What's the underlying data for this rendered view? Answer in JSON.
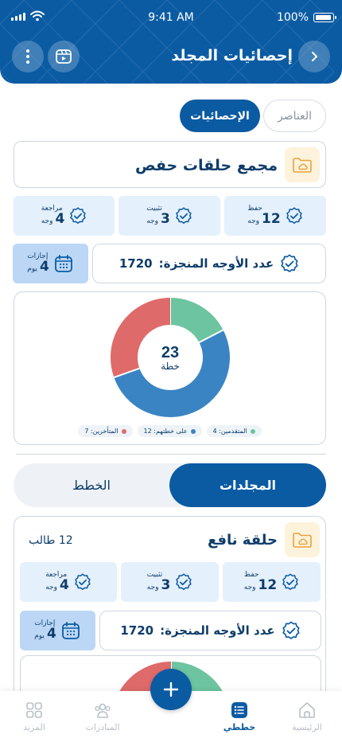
{
  "status_bar": {
    "time": "9:41 AM",
    "battery": "100%"
  },
  "header": {
    "title": "إحصائيات المجلد"
  },
  "top_tabs": {
    "stats": "الإحصائيات",
    "items": "العناصر"
  },
  "folder": {
    "title": "مجمع حلقات حفص",
    "tiles": [
      {
        "label": "حفظ",
        "value": "12",
        "unit": "وجه"
      },
      {
        "label": "تثبيت",
        "value": "3",
        "unit": "وجه"
      },
      {
        "label": "مراجعة",
        "value": "4",
        "unit": "وجه"
      }
    ],
    "faces_label": "عدد الأوجه المنجزة:",
    "faces_value": "1720",
    "leave": {
      "label": "إجازات",
      "value": "4",
      "unit": "يوم"
    }
  },
  "chart_data": {
    "type": "pie",
    "center_value": "23",
    "center_label": "خطة",
    "slices": [
      {
        "name": "المتقدمين",
        "value": 4,
        "color": "#6cc4a0"
      },
      {
        "name": "على خطتهم",
        "value": 12,
        "color": "#3b84c4"
      },
      {
        "name": "المتأخرين",
        "value": 7,
        "color": "#df6a6a"
      }
    ],
    "legend": [
      "المتقدمين: 4",
      "على خطتهم: 12",
      "المتأخرين: 7"
    ]
  },
  "view_tabs": {
    "folders": "المجلدات",
    "plans": "الخطط"
  },
  "circle": {
    "title": "حلقة نافع",
    "students": "12 طالب",
    "tiles": [
      {
        "label": "حفظ",
        "value": "12",
        "unit": "وجه"
      },
      {
        "label": "تثبيت",
        "value": "3",
        "unit": "وجه"
      },
      {
        "label": "مراجعة",
        "value": "4",
        "unit": "وجه"
      }
    ],
    "faces_label": "عدد الأوجه المنجزة:",
    "faces_value": "1720",
    "leave": {
      "label": "إجازات",
      "value": "4",
      "unit": "يوم"
    }
  },
  "bottom_nav": {
    "home": "الرئيسية",
    "plans": "خططي",
    "initiatives": "المبادرات",
    "more": "المزيد"
  },
  "colors": {
    "primary": "#0b5ba3",
    "tile_bg": "#e4f0fc",
    "leave_bg": "#bcd7f5",
    "folder_bg": "#fdf3dc",
    "folder_stroke": "#e8a33d"
  }
}
